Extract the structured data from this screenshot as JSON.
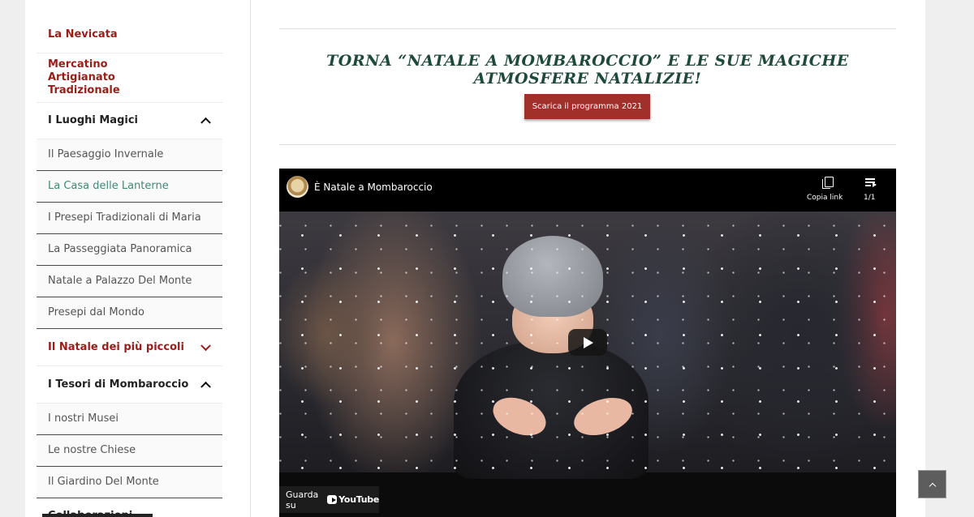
{
  "sidebar": {
    "items": [
      {
        "label": "La Nevicata"
      },
      {
        "label": "Mercatino Artigianato Tradizionale"
      },
      {
        "label": "I Luoghi Magici"
      },
      {
        "label": "Il Paesaggio Invernale"
      },
      {
        "label": "La Casa delle Lanterne"
      },
      {
        "label": "I Presepi Tradizionali di Maria"
      },
      {
        "label": "La Passeggiata Panoramica"
      },
      {
        "label": "Natale a Palazzo Del Monte"
      },
      {
        "label": "Presepi dal Mondo"
      },
      {
        "label": "Il Natale dei più piccoli"
      },
      {
        "label": "I Tesori di Mombaroccio"
      },
      {
        "label": "I nostri Musei"
      },
      {
        "label": "Le nostre Chiese"
      },
      {
        "label": "Il Giardino Del Monte"
      },
      {
        "label": "Collaborazioni"
      }
    ]
  },
  "main": {
    "title": "TORNA “NATALE A MOMBAROCCIO” E LE SUE MAGICHE ATMOSFERE NATALIZIE!",
    "download_button": "Scarica il programma 2021",
    "video": {
      "title": "È Natale a Mombaroccio",
      "copy_link_label": "Copia link",
      "playlist_count": "1/1",
      "watch_on": "Guarda su",
      "platform": "YouTube"
    }
  },
  "colors": {
    "accent_red": "#9a1d18",
    "button_red": "#a12f2a",
    "active_green": "#3f8a74",
    "title_green": "#1e4a3b"
  },
  "icons": [
    "chevron-up-icon",
    "chevron-down-icon",
    "copy-icon",
    "playlist-icon",
    "play-icon",
    "youtube-logo-icon",
    "arrow-up-icon"
  ]
}
